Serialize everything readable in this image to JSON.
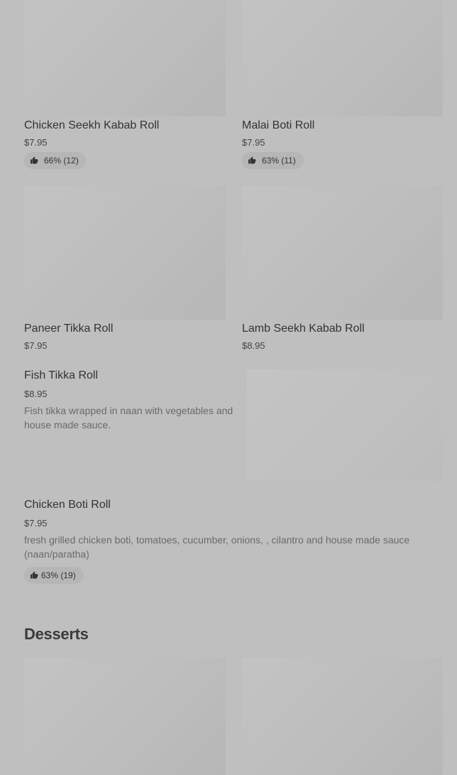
{
  "menu": {
    "items": [
      {
        "name": "Chicken Seekh Kabab Roll",
        "price": "$7.95",
        "rating": "66% (12)"
      },
      {
        "name": "Malai Boti Roll",
        "price": "$7.95",
        "rating": "63% (11)"
      },
      {
        "name": "Paneer Tikka Roll",
        "price": "$7.95"
      },
      {
        "name": "Lamb Seekh Kabab Roll",
        "price": "$8.95"
      },
      {
        "name": "Fish Tikka Roll",
        "price": "$8.95",
        "description": "Fish tikka wrapped in naan with vegetables and house made sauce."
      },
      {
        "name": "Chicken Boti Roll",
        "price": "$7.95",
        "description": "fresh grilled chicken boti, tomatoes, cucumber, onions, , cilantro and house made sauce (naan/paratha)",
        "rating": "63% (19)"
      }
    ]
  },
  "sections": {
    "desserts": {
      "title": "Desserts"
    }
  },
  "icons": {
    "rating": "thumbs-up-icon"
  },
  "colors": {
    "background": "#bfbfbf",
    "image_placeholder": "#c0c0c0",
    "badge": "#b6b6b6"
  }
}
